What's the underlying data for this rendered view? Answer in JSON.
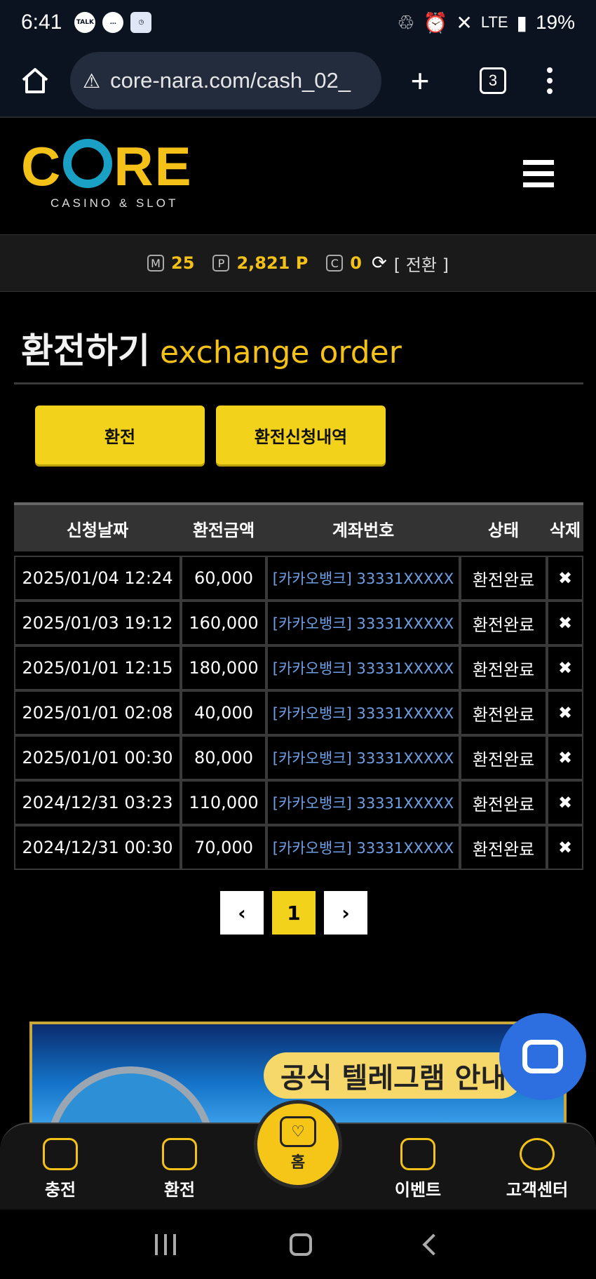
{
  "statusbar": {
    "time": "6:41",
    "left_icons": [
      "talk-icon",
      "message-icon",
      "calendar-icon"
    ],
    "talk_label": "TALK",
    "network": "LTE",
    "battery": "19%"
  },
  "browser": {
    "url": "core-nara.com/cash_02_",
    "tab_count": "3"
  },
  "site": {
    "logo_text": "CORE",
    "logo_sub": "CASINO & SLOT"
  },
  "points": {
    "m_icon": "M",
    "m_value": "25",
    "p_icon": "P",
    "p_value": "2,821 P",
    "c_icon": "C",
    "c_value": "0",
    "convert_label": "[ 전환 ]"
  },
  "page": {
    "title_ko": "환전하기",
    "title_en": "exchange order"
  },
  "buttons": {
    "exchange": "환전",
    "history": "환전신청내역"
  },
  "table": {
    "headers": [
      "신청날짜",
      "환전금액",
      "계좌번호",
      "상태",
      "삭제"
    ],
    "rows": [
      {
        "date": "2025/01/04 12:24",
        "amount": "60,000",
        "account": "[카카오뱅크] 33331XXXXX",
        "status": "환전완료",
        "delete": "✖"
      },
      {
        "date": "2025/01/03 19:12",
        "amount": "160,000",
        "account": "[카카오뱅크] 33331XXXXX",
        "status": "환전완료",
        "delete": "✖"
      },
      {
        "date": "2025/01/01 12:15",
        "amount": "180,000",
        "account": "[카카오뱅크] 33331XXXXX",
        "status": "환전완료",
        "delete": "✖"
      },
      {
        "date": "2025/01/01 02:08",
        "amount": "40,000",
        "account": "[카카오뱅크] 33331XXXXX",
        "status": "환전완료",
        "delete": "✖"
      },
      {
        "date": "2025/01/01 00:30",
        "amount": "80,000",
        "account": "[카카오뱅크] 33331XXXXX",
        "status": "환전완료",
        "delete": "✖"
      },
      {
        "date": "2024/12/31 03:23",
        "amount": "110,000",
        "account": "[카카오뱅크] 33331XXXXX",
        "status": "환전완료",
        "delete": "✖"
      },
      {
        "date": "2024/12/31 00:30",
        "amount": "70,000",
        "account": "[카카오뱅크] 33331XXXXX",
        "status": "환전완료",
        "delete": "✖"
      }
    ]
  },
  "pagination": {
    "prev": "‹",
    "current": "1",
    "next": "›"
  },
  "banner": {
    "text": "공식 텔레그램 안내"
  },
  "bottomnav": {
    "charge": "충전",
    "exchange": "환전",
    "home": "홈",
    "event": "이벤트",
    "support": "고객센터"
  },
  "colors": {
    "accent": "#f2d21a",
    "link": "#6fa0e6",
    "chat": "#2d6fe0"
  }
}
